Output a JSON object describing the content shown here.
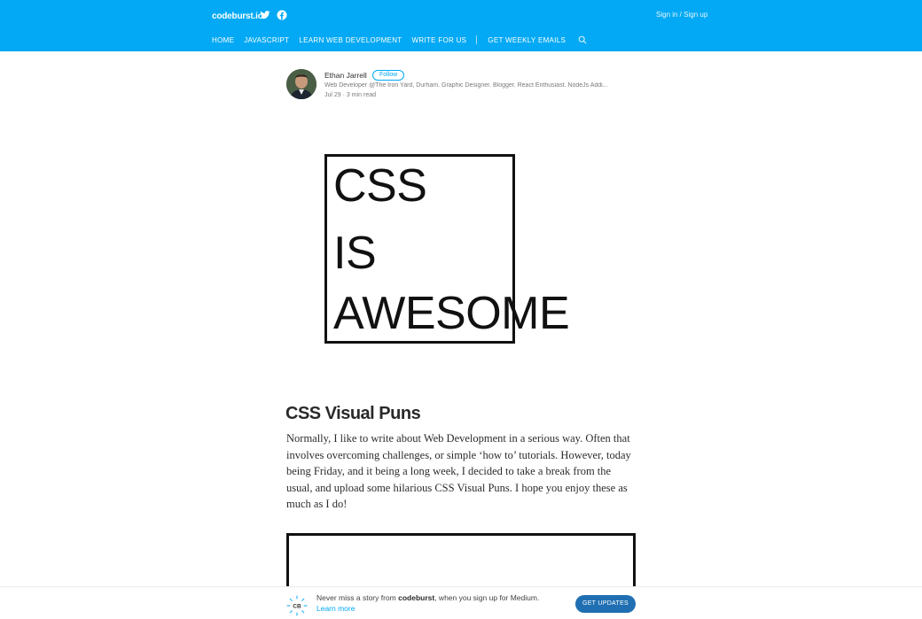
{
  "header": {
    "logo_text": "codeburst.io",
    "signin": "Sign in / Sign up",
    "nav": [
      "HOME",
      "JAVASCRIPT",
      "LEARN WEB DEVELOPMENT",
      "WRITE FOR US",
      "GET WEEKLY EMAILS"
    ],
    "accent": "#03a9f4"
  },
  "author": {
    "name": "Ethan Jarrell",
    "follow": "Follow",
    "bio": "Web Developer @The Iron Yard, Durham. Graphic Designer. Blogger. React Enthusiast. NodeJs Addi...",
    "date": "Jul 29",
    "read_time": "3 min read"
  },
  "hero": {
    "lines": [
      "CSS",
      "IS",
      "AWESOME"
    ]
  },
  "article": {
    "title": "CSS Visual Puns",
    "paragraph": "Normally, I like to write about Web Development in a serious way. Often that involves overcoming challenges, or simple ‘how to’ tutorials. However, today being Friday, and it being a long week, I decided to take a break from the usual, and upload some hilarious CSS Visual Puns. I hope you enjoy these as much as I do!"
  },
  "footer": {
    "logo_text": "CB",
    "prefix": "Never miss a story from ",
    "publication": "codeburst",
    "suffix": ", when you sign up for Medium. ",
    "learn_more": "Learn more",
    "cta": "GET UPDATES",
    "cta_color": "#1f6fb2"
  }
}
